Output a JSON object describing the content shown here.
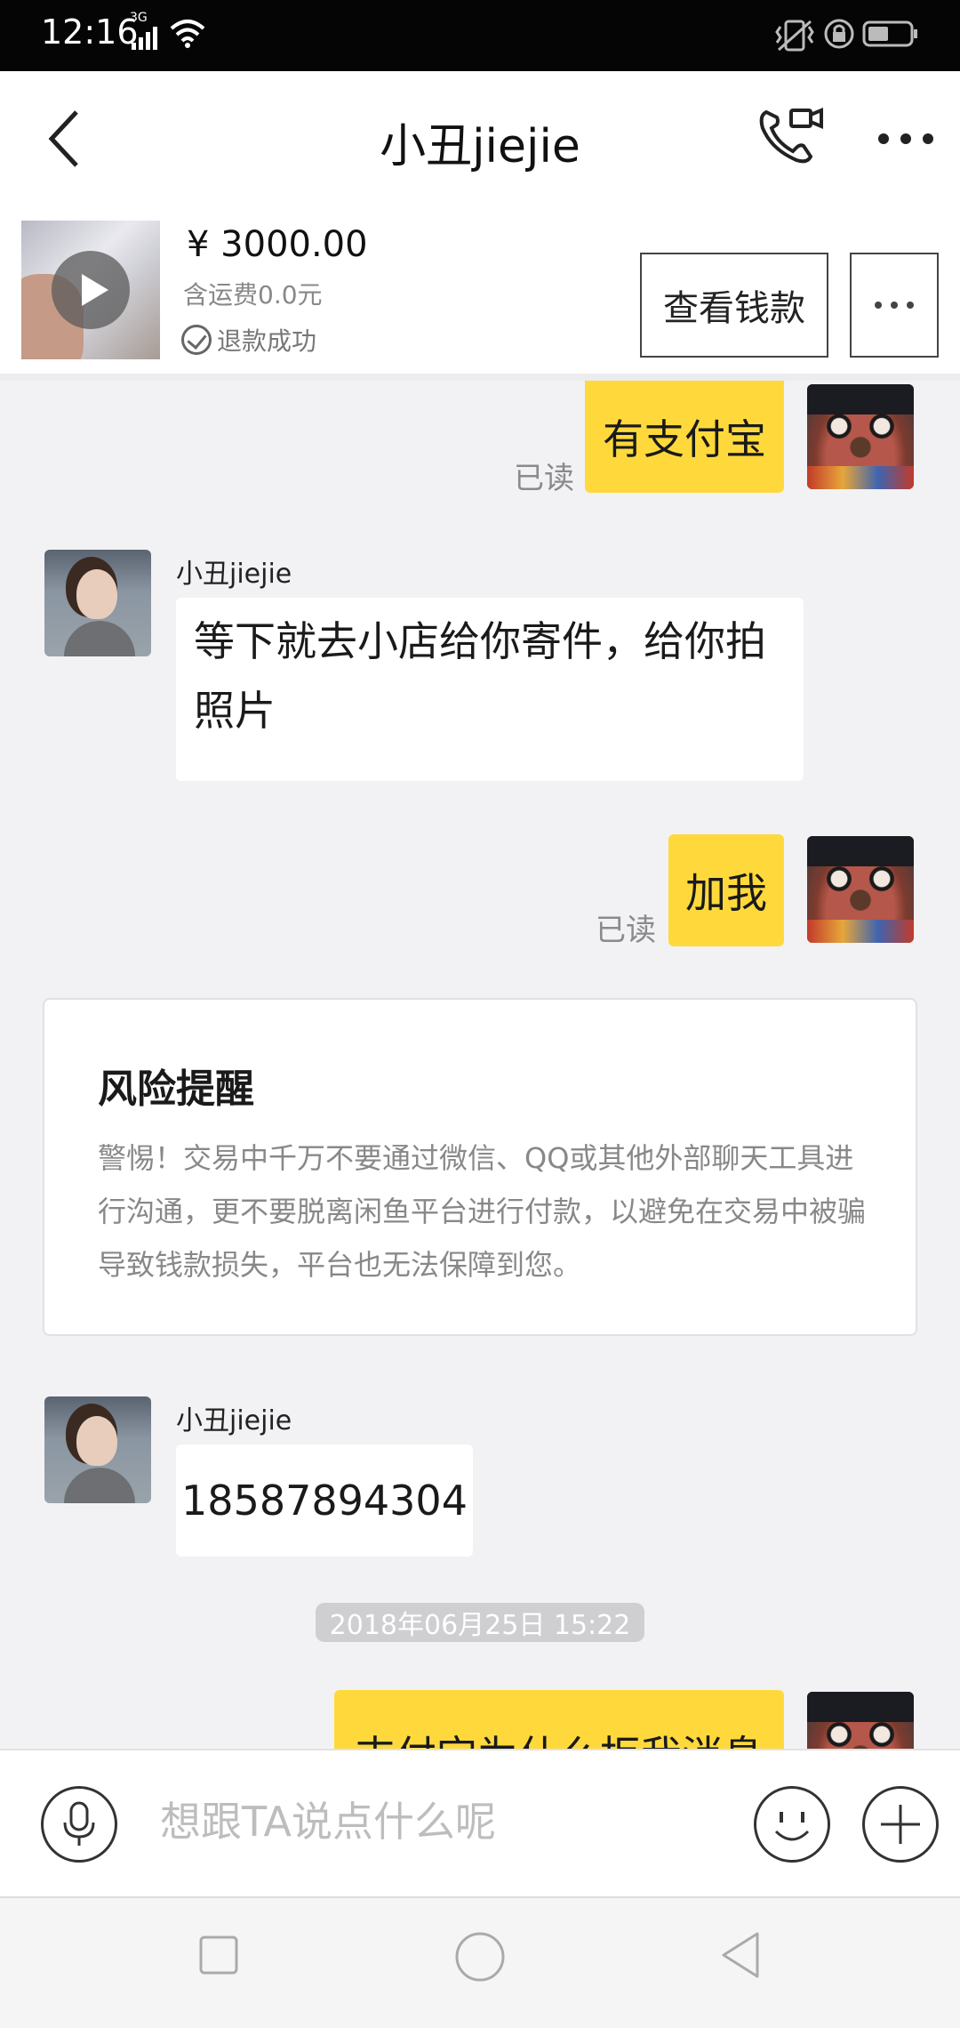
{
  "status_bar": {
    "time": "12:16",
    "network": "3G",
    "icons": [
      "signal-icon",
      "wifi-icon",
      "vibrate-icon",
      "lock-rotation-icon",
      "battery-icon"
    ]
  },
  "nav": {
    "title": "小丑jiejie",
    "back_icon": "back-chevron-icon",
    "call_icon": "phone-video-icon",
    "more_icon": "more-dots-icon"
  },
  "product": {
    "price": "¥ 3000.00",
    "shipping": "含运费0.0元",
    "status": "退款成功",
    "view_button": "查看钱款"
  },
  "messages": {
    "m1": {
      "text": "有支付宝",
      "read": "已读"
    },
    "m2": {
      "sender": "小丑jiejie",
      "text": "等下就去小店给你寄件，给你拍照片"
    },
    "m3": {
      "text": "加我",
      "read": "已读"
    },
    "risk": {
      "title": "风险提醒",
      "body": "警惕！交易中千万不要通过微信、QQ或其他外部聊天工具进行沟通，更不要脱离闲鱼平台进行付款，以避免在交易中被骗导致钱款损失，平台也无法保障到您。"
    },
    "m4": {
      "sender": "小丑jiejie",
      "text": "18587894304"
    },
    "timestamp": "2018年06月25日 15:22",
    "m5": {
      "text": "支付宝为什么拒我消息"
    }
  },
  "input": {
    "placeholder": "想跟TA说点什么呢",
    "voice_icon": "microphone-icon",
    "emoji_icon": "emoji-icon",
    "plus_icon": "plus-icon"
  },
  "colors": {
    "my_bubble": "#ffd93c",
    "chat_background": "#f2f2f4",
    "status_bar": "#050505"
  }
}
